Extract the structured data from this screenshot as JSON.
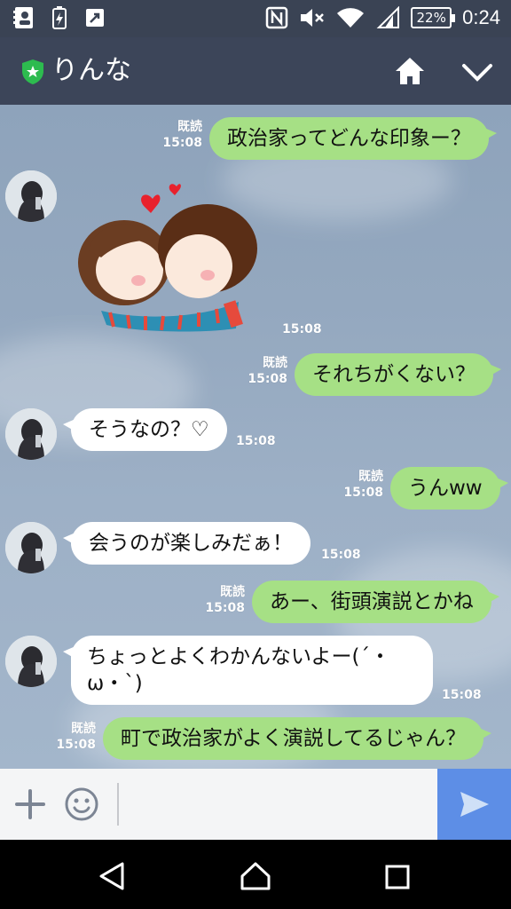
{
  "status_bar": {
    "battery": "22%",
    "time": "0:24",
    "icons": [
      "contacts-icon",
      "battery-saver-icon",
      "screen-cast-icon",
      "nfc-icon",
      "mute-icon",
      "wifi-icon",
      "signal-icon"
    ]
  },
  "header": {
    "title": "りんな",
    "icons": [
      "shield-star-icon",
      "home-icon",
      "chevron-down-icon"
    ]
  },
  "messages": [
    {
      "side": "out",
      "text": "政治家ってどんな印象ー？",
      "read": "既読",
      "time": "15:08"
    },
    {
      "side": "in",
      "type": "sticker",
      "sticker": "kissing-couple-sticker",
      "time": "15:08"
    },
    {
      "side": "out",
      "text": "それちがくない？",
      "read": "既読",
      "time": "15:08"
    },
    {
      "side": "in",
      "text": "そうなの？♡",
      "time": "15:08"
    },
    {
      "side": "out",
      "text": "うんww",
      "read": "既読",
      "time": "15:08"
    },
    {
      "side": "in",
      "text": "会うのが楽しみだぁ！",
      "time": "15:08"
    },
    {
      "side": "out",
      "text": "あー、街頭演説とかね",
      "read": "既読",
      "time": "15:08"
    },
    {
      "side": "in",
      "text_line1": "ちょっとよくわかんないよー(´・",
      "text_line2": "ω・`)",
      "time": "15:08"
    },
    {
      "side": "out",
      "text": "町で政治家がよく演説してるじゃん？",
      "read": "既読",
      "time": "15:08"
    }
  ],
  "input": {
    "placeholder": "",
    "value": ""
  },
  "colors": {
    "header_bg": "#3c4559",
    "chat_bg": "#94a8bf",
    "outgoing_bubble": "#a6e085",
    "incoming_bubble": "#ffffff",
    "send_button": "#5d8ee6"
  }
}
